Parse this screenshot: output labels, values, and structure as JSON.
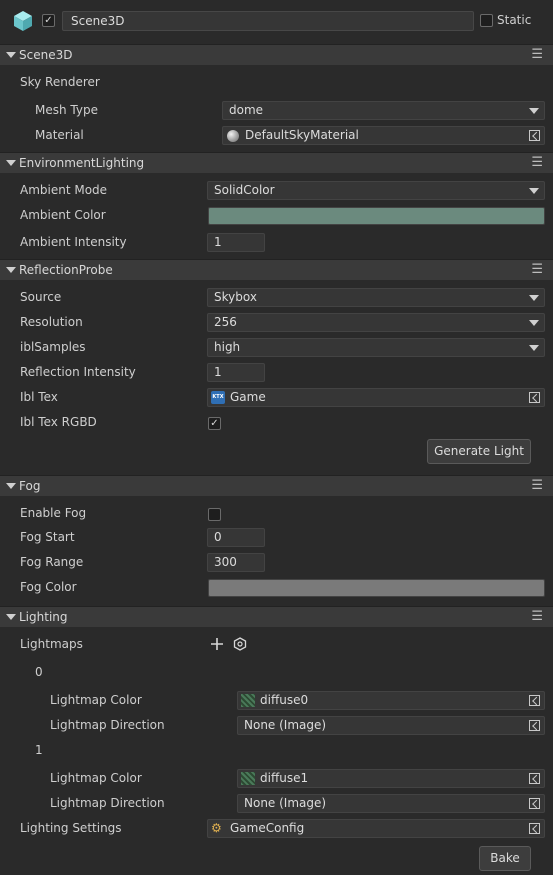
{
  "header": {
    "enabled_check": "✓",
    "name": "Scene3D",
    "static_label": "Static"
  },
  "sections": {
    "scene3d": {
      "title": "Scene3D",
      "sky_renderer": "Sky Renderer",
      "mesh_type_label": "Mesh Type",
      "mesh_type_value": "dome",
      "material_label": "Material",
      "material_value": "DefaultSkyMaterial"
    },
    "env": {
      "title": "EnvironmentLighting",
      "ambient_mode_label": "Ambient Mode",
      "ambient_mode_value": "SolidColor",
      "ambient_color_label": "Ambient Color",
      "ambient_color_hex": "#6b8a7e",
      "ambient_intensity_label": "Ambient Intensity",
      "ambient_intensity_value": "1"
    },
    "reflection": {
      "title": "ReflectionProbe",
      "source_label": "Source",
      "source_value": "Skybox",
      "resolution_label": "Resolution",
      "resolution_value": "256",
      "ibl_samples_label": "iblSamples",
      "ibl_samples_value": "high",
      "intensity_label": "Reflection Intensity",
      "intensity_value": "1",
      "ibl_tex_label": "Ibl Tex",
      "ibl_tex_value": "Game",
      "ibl_tex_rgbd_label": "Ibl Tex RGBD",
      "ibl_tex_rgbd_check": "✓",
      "generate_button": "Generate Light"
    },
    "fog": {
      "title": "Fog",
      "enable_label": "Enable Fog",
      "start_label": "Fog Start",
      "start_value": "0",
      "range_label": "Fog Range",
      "range_value": "300",
      "color_label": "Fog Color",
      "color_hex": "#7a7a7a"
    },
    "lighting": {
      "title": "Lighting",
      "lightmaps_label": "Lightmaps",
      "lightmaps": [
        {
          "index": "0",
          "color_label": "Lightmap Color",
          "color_value": "diffuse0",
          "direction_label": "Lightmap Direction",
          "direction_value": "None (Image)"
        },
        {
          "index": "1",
          "color_label": "Lightmap Color",
          "color_value": "diffuse1",
          "direction_label": "Lightmap Direction",
          "direction_value": "None (Image)"
        }
      ],
      "settings_label": "Lighting Settings",
      "settings_value": "GameConfig",
      "bake_button": "Bake"
    }
  },
  "menu_glyph": "☰",
  "colors": {
    "panel_bg": "#2a2a2a",
    "header_bg": "#3a3a3a",
    "field_bg": "#363636",
    "cube_icon": "#7fd4d9"
  }
}
